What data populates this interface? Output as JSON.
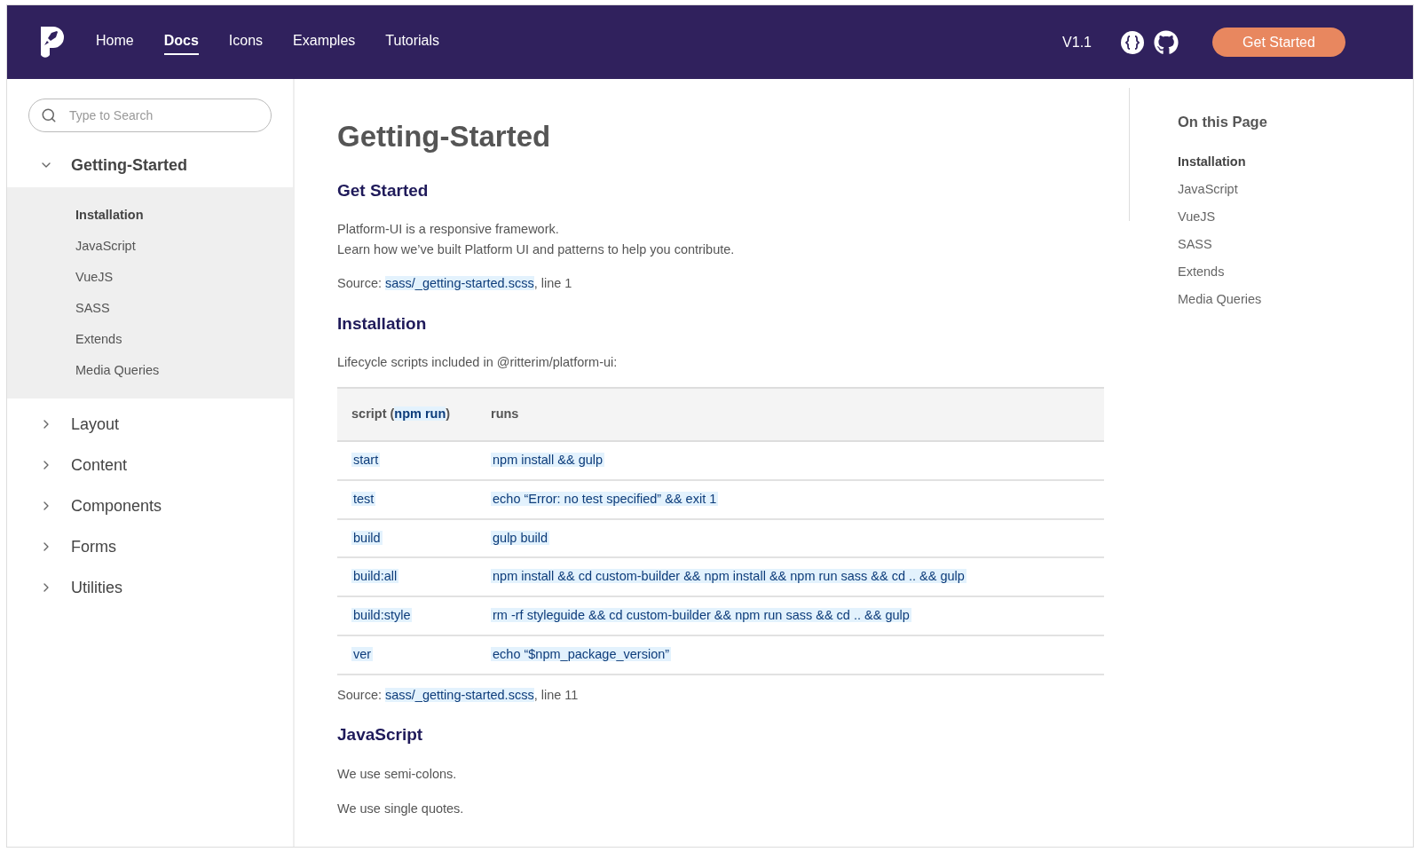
{
  "header": {
    "nav": [
      {
        "label": "Home",
        "selected": false
      },
      {
        "label": "Docs",
        "selected": true
      },
      {
        "label": "Icons",
        "selected": false
      },
      {
        "label": "Examples",
        "selected": false
      },
      {
        "label": "Tutorials",
        "selected": false
      }
    ],
    "version": "V1.1",
    "cta": "Get Started"
  },
  "sidebar": {
    "search": {
      "placeholder": "Type to Search"
    },
    "sections": [
      {
        "label": "Getting-Started",
        "expanded": true,
        "children": [
          {
            "label": "Installation",
            "selected": true
          },
          {
            "label": "JavaScript",
            "selected": false
          },
          {
            "label": "VueJS",
            "selected": false
          },
          {
            "label": "SASS",
            "selected": false
          },
          {
            "label": "Extends",
            "selected": false
          },
          {
            "label": "Media Queries",
            "selected": false
          }
        ]
      },
      {
        "label": "Layout",
        "expanded": false
      },
      {
        "label": "Content",
        "expanded": false
      },
      {
        "label": "Components",
        "expanded": false
      },
      {
        "label": "Forms",
        "expanded": false
      },
      {
        "label": "Utilities",
        "expanded": false
      }
    ]
  },
  "main": {
    "title": "Getting-Started",
    "sections": [
      {
        "heading": "Get Started",
        "blocks": [
          {
            "kind": "paragraph",
            "lines": [
              "Platform-UI is a responsive framework.",
              "Learn how we’ve built Platform UI and patterns to help you contribute."
            ]
          },
          {
            "kind": "source",
            "prefix": "Source:",
            "link": "sass/_getting-started.scss",
            "suffix": ", line 1"
          }
        ]
      },
      {
        "heading": "Installation",
        "blocks": [
          {
            "kind": "paragraph",
            "lines": [
              "Lifecycle scripts included in @ritterim/platform-ui:"
            ]
          },
          {
            "kind": "table",
            "columns": [
              "script (**npm run**)",
              "runs"
            ],
            "rows": [
              [
                "start",
                "npm install && gulp"
              ],
              [
                "test",
                "echo “Error: no test specified” && exit 1"
              ],
              [
                "build",
                "gulp build"
              ],
              [
                "build:all",
                "npm install && cd custom-builder && npm install && npm run sass && cd .. && gulp"
              ],
              [
                "build:style",
                "rm -rf styleguide && cd custom-builder && npm run sass && cd .. && gulp"
              ],
              [
                "ver",
                "echo “$npm_package_version”"
              ]
            ]
          },
          {
            "kind": "source",
            "prefix": "Source:",
            "link": "sass/_getting-started.scss",
            "suffix": ", line 11"
          }
        ]
      },
      {
        "heading": "JavaScript",
        "blocks": [
          {
            "kind": "paragraph",
            "lines": [
              "We use semi-colons."
            ]
          },
          {
            "kind": "paragraph",
            "lines": [
              "We use single quotes."
            ]
          }
        ]
      }
    ]
  },
  "toc": {
    "title": "On this Page",
    "items": [
      {
        "label": "Installation",
        "selected": true
      },
      {
        "label": "JavaScript",
        "selected": false
      },
      {
        "label": "VueJS",
        "selected": false
      },
      {
        "label": "SASS",
        "selected": false
      },
      {
        "label": "Extends",
        "selected": false
      },
      {
        "label": "Media Queries",
        "selected": false
      }
    ]
  }
}
